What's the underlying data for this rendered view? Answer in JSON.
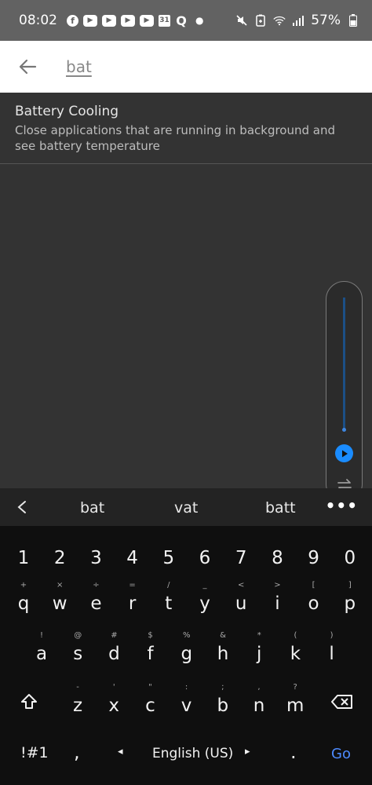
{
  "status_bar": {
    "time": "08:02",
    "battery": "57%",
    "icons_left": [
      "facebook-icon",
      "youtube-icon",
      "youtube-icon",
      "youtube-icon",
      "youtube-icon",
      "calendar-icon",
      "q-app-icon",
      "dot-icon"
    ],
    "calendar_text": "31",
    "q_text": "Q",
    "icons_right": [
      "mute-icon",
      "battery-saver-icon",
      "wifi-icon",
      "signal-icon",
      "battery-icon"
    ]
  },
  "search": {
    "query": "bat"
  },
  "results": [
    {
      "title": "Battery Cooling",
      "description": "Close applications that are running in background and see battery temperature"
    }
  ],
  "volume": {
    "level": 0.01
  },
  "keyboard": {
    "suggestions": [
      "bat",
      "vat",
      "batt"
    ],
    "more": "•••",
    "number_row": [
      "1",
      "2",
      "3",
      "4",
      "5",
      "6",
      "7",
      "8",
      "9",
      "0"
    ],
    "row1": [
      {
        "k": "q",
        "s": "+"
      },
      {
        "k": "w",
        "s": "×"
      },
      {
        "k": "e",
        "s": "÷"
      },
      {
        "k": "r",
        "s": "="
      },
      {
        "k": "t",
        "s": "/"
      },
      {
        "k": "y",
        "s": "_"
      },
      {
        "k": "u",
        "s": "<"
      },
      {
        "k": "i",
        "s": ">"
      },
      {
        "k": "o",
        "s": "["
      },
      {
        "k": "p",
        "s": "]"
      }
    ],
    "row2": [
      {
        "k": "a",
        "s": "!"
      },
      {
        "k": "s",
        "s": "@"
      },
      {
        "k": "d",
        "s": "#"
      },
      {
        "k": "f",
        "s": "$"
      },
      {
        "k": "g",
        "s": "%"
      },
      {
        "k": "h",
        "s": "&"
      },
      {
        "k": "j",
        "s": "*"
      },
      {
        "k": "k",
        "s": "("
      },
      {
        "k": "l",
        "s": ")"
      }
    ],
    "row3": [
      {
        "k": "z",
        "s": "-"
      },
      {
        "k": "x",
        "s": "'"
      },
      {
        "k": "c",
        "s": "\""
      },
      {
        "k": "v",
        "s": ":"
      },
      {
        "k": "b",
        "s": ";"
      },
      {
        "k": "n",
        "s": ","
      },
      {
        "k": "m",
        "s": "?"
      }
    ],
    "symbols_key": "!#1",
    "comma_key": ",",
    "language": "English (US)",
    "period_key": ".",
    "go_key": "Go",
    "left_arrow": "◂",
    "right_arrow": "▸"
  },
  "colors": {
    "status_bar_bg": "#626262",
    "results_bg": "#333333",
    "keyboard_bg": "#0f0f0f",
    "accent": "#1a8cff",
    "go": "#4d8bff"
  }
}
